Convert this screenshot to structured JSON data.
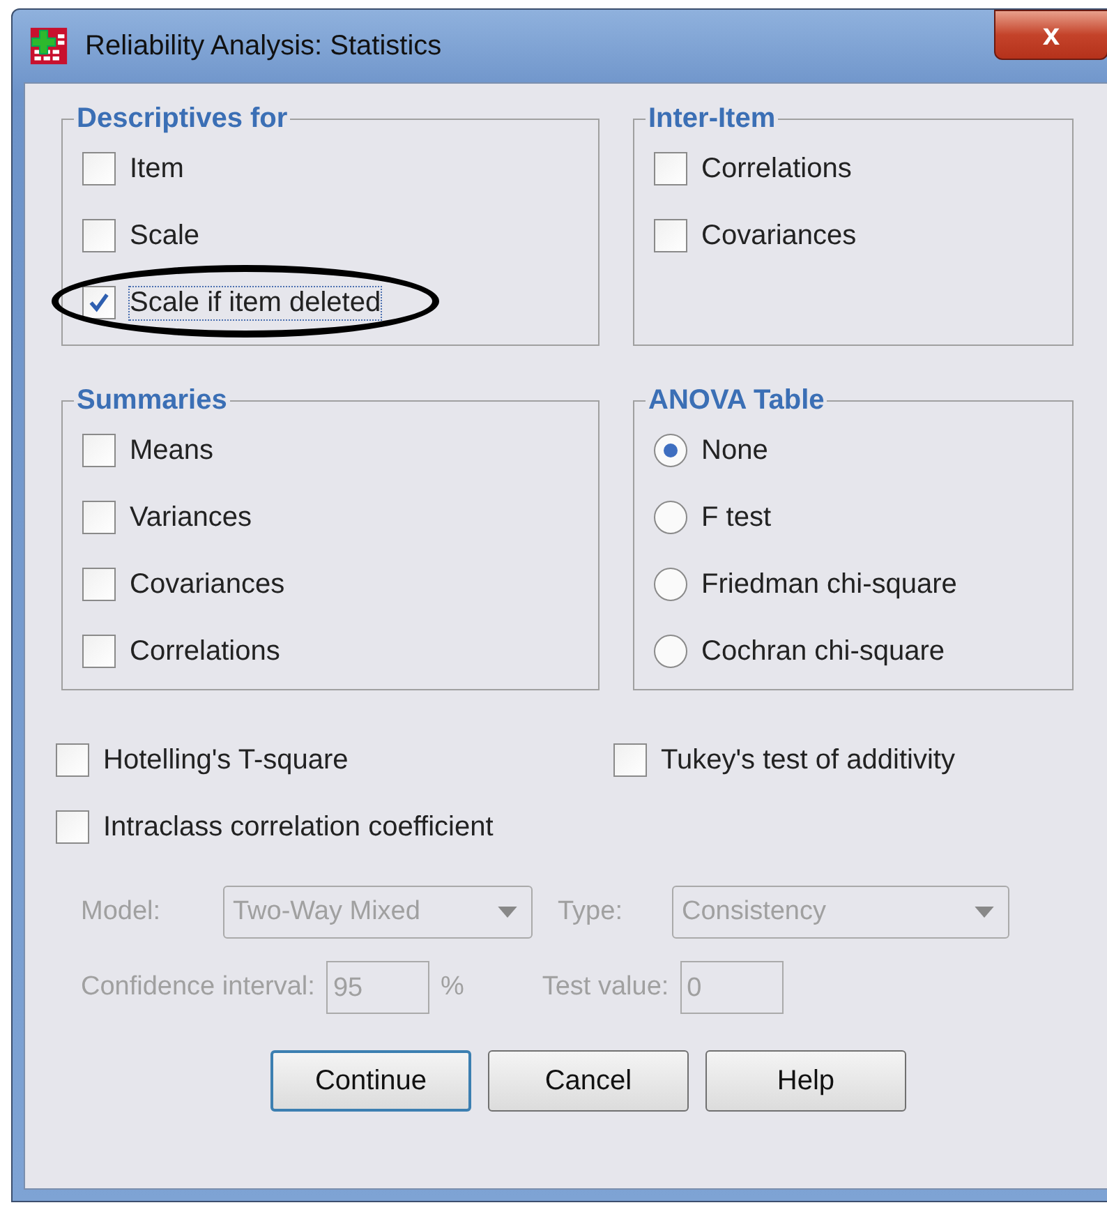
{
  "window": {
    "title": "Reliability Analysis: Statistics",
    "close_label": "x"
  },
  "groups": [
    {
      "title": "Descriptives for",
      "kind": "checkbox",
      "items": [
        {
          "label": "Item",
          "checked": false,
          "circled": false
        },
        {
          "label": "Scale",
          "checked": false,
          "circled": false
        },
        {
          "label": "Scale if item deleted",
          "checked": true,
          "circled": true
        }
      ]
    },
    {
      "title": "Inter-Item",
      "kind": "checkbox",
      "items": [
        {
          "label": "Correlations",
          "checked": false,
          "circled": false
        },
        {
          "label": "Covariances",
          "checked": false,
          "circled": false
        }
      ]
    },
    {
      "title": "Summaries",
      "kind": "checkbox",
      "items": [
        {
          "label": "Means",
          "checked": false,
          "circled": false
        },
        {
          "label": "Variances",
          "checked": false,
          "circled": false
        },
        {
          "label": "Covariances",
          "checked": false,
          "circled": false
        },
        {
          "label": "Correlations",
          "checked": false,
          "circled": false
        }
      ]
    },
    {
      "title": "ANOVA Table",
      "kind": "radio",
      "items": [
        {
          "label": "None",
          "selected": true,
          "circled": false
        },
        {
          "label": "F test",
          "selected": false,
          "circled": false
        },
        {
          "label": "Friedman chi-square",
          "selected": false,
          "circled": false
        },
        {
          "label": "Cochran chi-square",
          "selected": false,
          "circled": false
        }
      ]
    }
  ],
  "options": [
    {
      "label": "Hotelling's T-square",
      "checked": false
    },
    {
      "label": "Tukey's test of additivity",
      "checked": false
    },
    {
      "label": "Intraclass correlation coefficient",
      "checked": false
    }
  ],
  "icc": {
    "disabled": true,
    "model": {
      "label": "Model:",
      "value": "Two-Way Mixed"
    },
    "type": {
      "label": "Type:",
      "value": "Consistency"
    },
    "confidence": {
      "label": "Confidence interval:",
      "value": "95",
      "unit": "%"
    },
    "test_value": {
      "label": "Test value:",
      "value": "0"
    }
  },
  "buttons": [
    {
      "label": "Continue",
      "default": true
    },
    {
      "label": "Cancel",
      "default": false
    },
    {
      "label": "Help",
      "default": false
    }
  ]
}
